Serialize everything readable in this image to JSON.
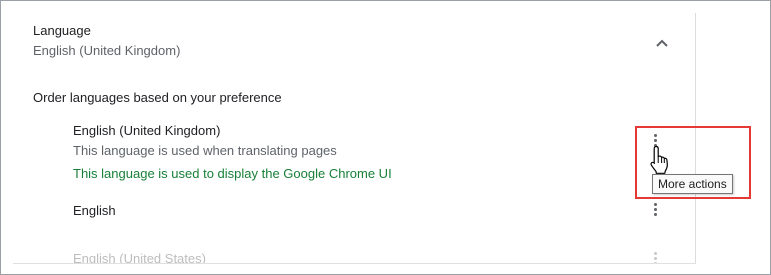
{
  "language": {
    "title": "Language",
    "current": "English (United Kingdom)"
  },
  "order_label": "Order languages based on your preference",
  "languages": [
    {
      "name": "English (United Kingdom)",
      "note": "This language is used when translating pages",
      "ui_note": "This language is used to display the Google Chrome UI"
    },
    {
      "name": "English"
    },
    {
      "name": "English (United States)"
    }
  ],
  "tooltip": "More actions",
  "icons": {
    "collapse": "chevron-up-icon",
    "menu": "more-vert-icon",
    "cursor": "hand-pointer-icon"
  },
  "colors": {
    "highlight": "#e53935",
    "ui_note": "#188038"
  }
}
